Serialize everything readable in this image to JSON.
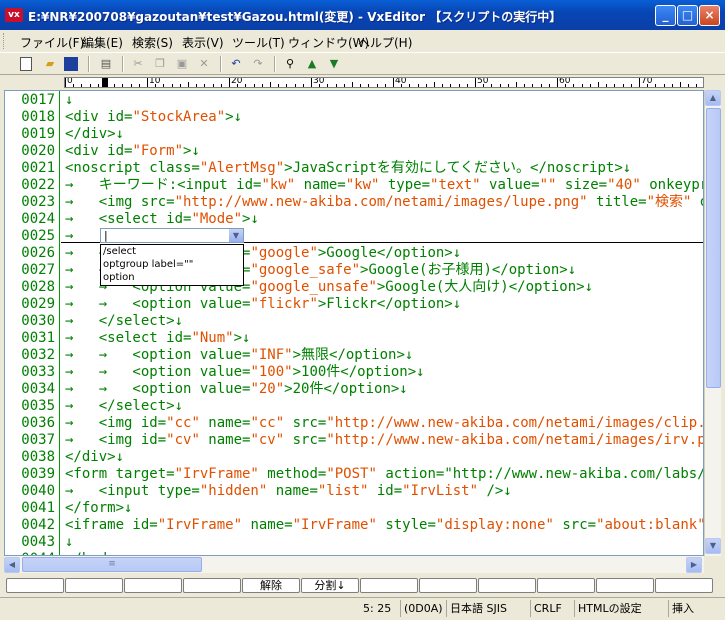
{
  "window": {
    "app_icon": "vx",
    "title": "E:¥NR¥200708¥gazoutan¥test¥Gazou.html(変更) - VxEditor 【スクリプトの実行中】",
    "minimize": "_",
    "maximize": "□",
    "close": "×"
  },
  "menu": [
    "ファイル(F)",
    "編集(E)",
    "検索(S)",
    "表示(V)",
    "ツール(T)",
    "ウィンドウ(W)",
    "ヘルプ(H)"
  ],
  "ruler": {
    "labels": [
      "0",
      "10",
      "20",
      "30",
      "40",
      "50",
      "60",
      "70"
    ]
  },
  "lines": [
    {
      "n": "0017",
      "code": "↓"
    },
    {
      "n": "0018",
      "code": "<div id=\"StockArea\">↓"
    },
    {
      "n": "0019",
      "code": "</div>↓"
    },
    {
      "n": "0020",
      "code": "<div id=\"Form\">↓"
    },
    {
      "n": "0021",
      "code": "<noscript class=\"AlertMsg\">JavaScriptを有効にしてください。</noscript>↓"
    },
    {
      "n": "0022",
      "code": "→   キーワード:<input id=\"kw\" name=\"kw\" type=\"text\" value=\"\" size=\"40\" onkeypres"
    },
    {
      "n": "0023",
      "code": "→   <img src=\"http://www.new-akiba.com/netami/images/lupe.png\" title=\"検索\" oncl"
    },
    {
      "n": "0024",
      "code": "→   <select id=\"Mode\">↓"
    },
    {
      "n": "0025",
      "code": "→   "
    },
    {
      "n": "0026",
      "code": "→   →   <option value=\"google\">Google</option>↓"
    },
    {
      "n": "0027",
      "code": "→   →   <option value=\"google_safe\">Google(お子様用)</option>↓"
    },
    {
      "n": "0028",
      "code": "→   →   <option value=\"google_unsafe\">Google(大人向け)</option>↓"
    },
    {
      "n": "0029",
      "code": "→   →   <option value=\"flickr\">Flickr</option>↓"
    },
    {
      "n": "0030",
      "code": "→   </select>↓"
    },
    {
      "n": "0031",
      "code": "→   <select id=\"Num\">↓"
    },
    {
      "n": "0032",
      "code": "→   →   <option value=\"INF\">無限</option>↓"
    },
    {
      "n": "0033",
      "code": "→   →   <option value=\"100\">100件</option>↓"
    },
    {
      "n": "0034",
      "code": "→   →   <option value=\"20\">20件</option>↓"
    },
    {
      "n": "0035",
      "code": "→   </select>↓"
    },
    {
      "n": "0036",
      "code": "→   <img id=\"cc\" name=\"cc\" src=\"http://www.new-akiba.com/netami/images/clip.png\""
    },
    {
      "n": "0037",
      "code": "→   <img id=\"cv\" name=\"cv\" src=\"http://www.new-akiba.com/netami/images/irv.png\""
    },
    {
      "n": "0038",
      "code": "</div>↓"
    },
    {
      "n": "0039",
      "code": "<form target=\"IrvFrame\" method=\"POST\" action=\"http://www.new-akiba.com/labs/luke"
    },
    {
      "n": "0040",
      "code": "→   <input type=\"hidden\" name=\"list\" id=\"IrvList\" />↓"
    },
    {
      "n": "0041",
      "code": "</form>↓"
    },
    {
      "n": "0042",
      "code": "<iframe id=\"IrvFrame\" name=\"IrvFrame\" style=\"display:none\" src=\"about:blank\" />↓"
    },
    {
      "n": "0043",
      "code": "↓"
    },
    {
      "n": "0044",
      "code": "</body>↓"
    }
  ],
  "autocomplete": {
    "input_value": "|",
    "options": [
      "/select",
      "optgroup label=\"\"",
      "option"
    ]
  },
  "function_keys": [
    "",
    "",
    "",
    "",
    "解除",
    "分割↓",
    "",
    "",
    "",
    "",
    "",
    ""
  ],
  "status": {
    "position": "5: 25",
    "code": "(0D0A)",
    "encoding": "日本語 SJIS",
    "newline": "CRLF",
    "mode": "HTMLの設定",
    "insert": "挿入"
  },
  "colors": {
    "titlebar": "#0a4fc4",
    "linenum": "#008000",
    "string": "#e05000"
  }
}
